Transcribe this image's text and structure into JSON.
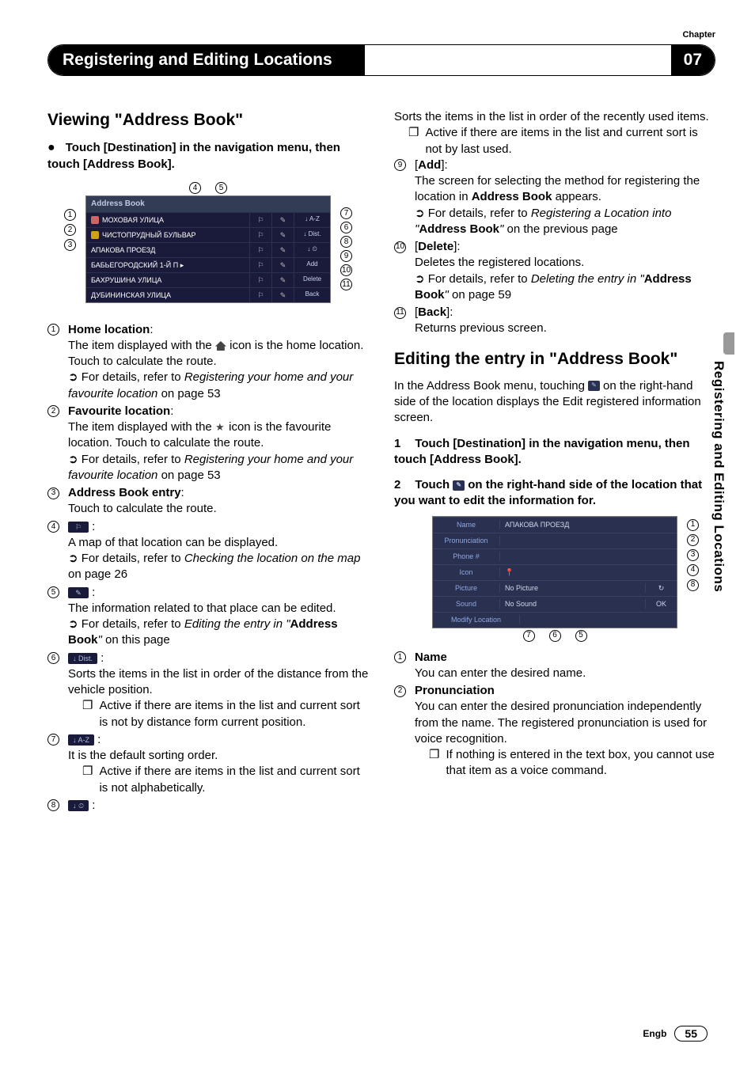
{
  "chapter_label": "Chapter",
  "chapter_num": "07",
  "header_title": "Registering and Editing Locations",
  "side_tab": "Registering and Editing Locations",
  "footer_lang": "Engb",
  "footer_page": "55",
  "left": {
    "h2": "Viewing \"Address Book\"",
    "lead": "Touch [Destination] in the navigation menu, then touch [Address Book].",
    "fig": {
      "title": "Address Book",
      "rows": [
        {
          "icon": "home",
          "text": "МОХОВАЯ УЛИЦА"
        },
        {
          "icon": "fav",
          "text": "ЧИСТОПРУДНЫЙ БУЛЬВАР"
        },
        {
          "icon": "",
          "text": "АПАКОВА ПРОЕЗД"
        },
        {
          "icon": "",
          "text": "БАБЬЕГОРОДСКИЙ 1-Й П ▸"
        },
        {
          "icon": "",
          "text": "БАХРУШИНА УЛИЦА"
        },
        {
          "icon": "",
          "text": "ДУБИНИНСКАЯ УЛИЦА"
        }
      ],
      "side_btns": [
        "↓ A-Z",
        "↓ Dist.",
        "↓ ⏲",
        "Add",
        "Delete",
        "Back"
      ],
      "top_callouts": [
        "4",
        "5"
      ],
      "left_callouts": [
        "1",
        "2",
        "3"
      ],
      "right_callouts": [
        "7",
        "6",
        "8",
        "9",
        "10",
        "11"
      ]
    },
    "items": [
      {
        "n": "1",
        "title": "Home location",
        "paras": [
          "The item displayed with the [home] icon is the home location. Touch to calculate the route."
        ],
        "ref": "For details, refer to ",
        "ref_em": "Registering your home and your favourite location",
        "ref_tail": " on page 53"
      },
      {
        "n": "2",
        "title": "Favourite location",
        "paras": [
          "The item displayed with the [star] icon is the favourite location. Touch to calculate the route."
        ],
        "ref": "For details, refer to ",
        "ref_em": "Registering your home and your favourite location",
        "ref_tail": " on page 53"
      },
      {
        "n": "3",
        "title": "Address Book entry",
        "paras": [
          "Touch to calculate the route."
        ]
      },
      {
        "n": "4",
        "icon_btn": "⚐",
        "paras": [
          "A map of that location can be displayed."
        ],
        "ref": "For details, refer to ",
        "ref_bold_em": "Checking the location on the map",
        "ref_tail": " on page 26"
      },
      {
        "n": "5",
        "icon_btn": "✎",
        "paras": [
          "The information related to that place can be edited."
        ],
        "ref": "For details, refer to ",
        "ref_em": "Editing the entry in \"",
        "ref_strong": "Address Book",
        "ref_em2": "\"",
        "ref_tail": " on this page"
      },
      {
        "n": "6",
        "icon_btn": "↓ Dist.",
        "paras": [
          "Sorts the items in the list in order of the distance from the vehicle position."
        ],
        "note": "Active if there are items in the list and current sort is not by distance form current position."
      },
      {
        "n": "7",
        "icon_btn": "↓ A-Z",
        "paras": [
          "It is the default sorting order."
        ],
        "note": "Active if there are items in the list and current sort is not alphabetically."
      },
      {
        "n": "8",
        "icon_btn": "↓ ⏲"
      }
    ]
  },
  "right": {
    "cont": {
      "paras": [
        "Sorts the items in the list in order of the recently used items."
      ],
      "note": "Active if there are items in the list and current sort is not by last used."
    },
    "items": [
      {
        "n": "9",
        "bracket": "Add",
        "paras": [
          "The screen for selecting the method for registering the location in Address Book appears."
        ],
        "ref": "For details, refer to ",
        "ref_em": "Registering a Location into \"",
        "ref_strong": "Address Book",
        "ref_em2": "\"",
        "ref_tail": " on the previous page"
      },
      {
        "n": "10",
        "bracket": "Delete",
        "paras": [
          "Deletes the registered locations."
        ],
        "ref": "For details, refer to ",
        "ref_em": "Deleting the entry in \"",
        "ref_strong": "Address Book",
        "ref_em2": "\"",
        "ref_tail": " on page 59"
      },
      {
        "n": "11",
        "bracket": "Back",
        "paras": [
          "Returns previous screen."
        ]
      }
    ],
    "h2": "Editing the entry in \"Address Book\"",
    "intro_a": "In the Address Book menu, touching ",
    "intro_b": " on the right-hand side of the location displays the Edit registered information screen.",
    "step1": "Touch [Destination] in the navigation menu, then touch [Address Book].",
    "step2_a": "Touch ",
    "step2_b": " on the right-hand side of the location that you want to edit the information for.",
    "editfig": {
      "rows": [
        {
          "lbl": "Name",
          "val": "АПАКОВА ПРОЕЗД"
        },
        {
          "lbl": "Pronunciation",
          "val": ""
        },
        {
          "lbl": "Phone #",
          "val": ""
        },
        {
          "lbl": "Icon",
          "val": "📍"
        },
        {
          "lbl": "Picture",
          "val": "No Picture",
          "extra": "↻"
        },
        {
          "lbl": "Sound",
          "val": "No Sound",
          "extra": "OK"
        },
        {
          "lbl": "Modify Location",
          "val": ""
        }
      ],
      "right_callouts": [
        "1",
        "2",
        "3",
        "4",
        "8"
      ],
      "bottom_callouts": [
        "7",
        "6",
        "5"
      ]
    },
    "defs": [
      {
        "n": "1",
        "title": "Name",
        "text": "You can enter the desired name."
      },
      {
        "n": "2",
        "title": "Pronunciation",
        "text": "You can enter the desired pronunciation independently from the name. The registered pronunciation is used for voice recognition.",
        "note": "If nothing is entered in the text box, you cannot use that item as a voice command."
      }
    ]
  }
}
